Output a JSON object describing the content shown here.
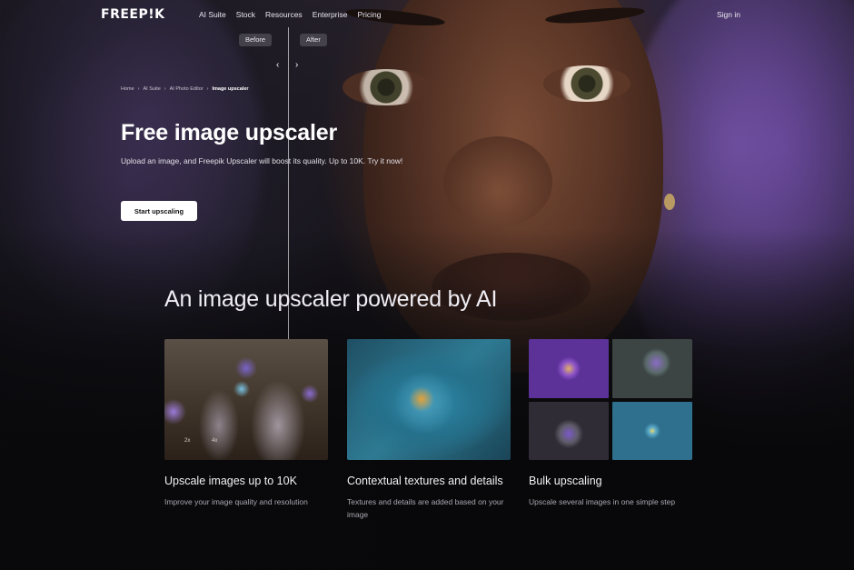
{
  "nav": {
    "logo": "FREEP!K",
    "links": [
      "AI Suite",
      "Stock",
      "Resources",
      "Enterprise",
      "Pricing"
    ],
    "sign_in": "Sign in"
  },
  "compare": {
    "before_label": "Before",
    "after_label": "After",
    "prev_arrow": "‹",
    "next_arrow": "›"
  },
  "breadcrumb": {
    "items": [
      "Home",
      "AI Suite",
      "AI Photo Editor"
    ],
    "current": "Image upscaler",
    "separator": "›"
  },
  "hero": {
    "title": "Free image upscaler",
    "subtitle": "Upload an image, and Freepik Upscaler will boost its quality. Up to 10K. Try it now!",
    "cta": "Start upscaling"
  },
  "features": {
    "title": "An image upscaler powered by AI",
    "cards": [
      {
        "title": "Upscale images up to 10K",
        "desc": "Improve your image quality and resolution",
        "image": "hands-planting-flowers",
        "badges": [
          "2x",
          "4x"
        ]
      },
      {
        "title": "Contextual textures and details",
        "desc": "Textures and details are added based on your image",
        "image": "blue-flower"
      },
      {
        "title": "Bulk upscaling",
        "desc": "Upscale several images in one simple step",
        "image": "flower-image-grid"
      }
    ]
  }
}
